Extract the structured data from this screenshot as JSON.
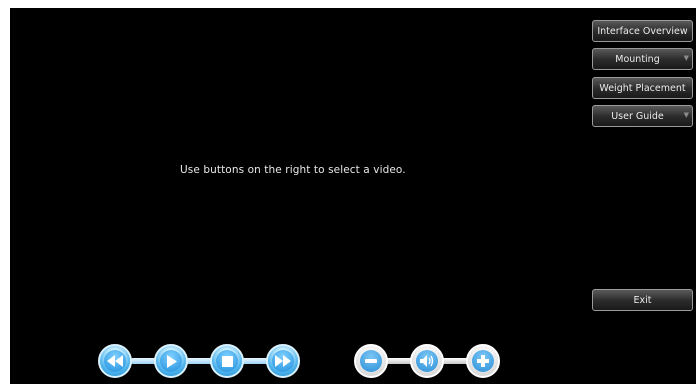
{
  "player": {
    "message": "Use buttons on the right to select a video."
  },
  "menu": {
    "items": [
      {
        "label": "Interface Overview",
        "has_dropdown": false
      },
      {
        "label": "Mounting",
        "has_dropdown": true
      },
      {
        "label": "Weight Placement",
        "has_dropdown": false
      },
      {
        "label": "User Guide",
        "has_dropdown": true
      }
    ],
    "exit_label": "Exit",
    "dropdown_icon": "chevron-down-icon"
  },
  "controls": {
    "playback": [
      "rewind-icon",
      "play-icon",
      "stop-icon",
      "fast-forward-icon"
    ],
    "volume": [
      "minus-icon",
      "speaker-icon",
      "plus-icon"
    ]
  },
  "colors": {
    "background": "#000000",
    "playback_accent": "#2a9ae0",
    "volume_accent": "#d8d8d8",
    "text": "#e8e8e8"
  }
}
